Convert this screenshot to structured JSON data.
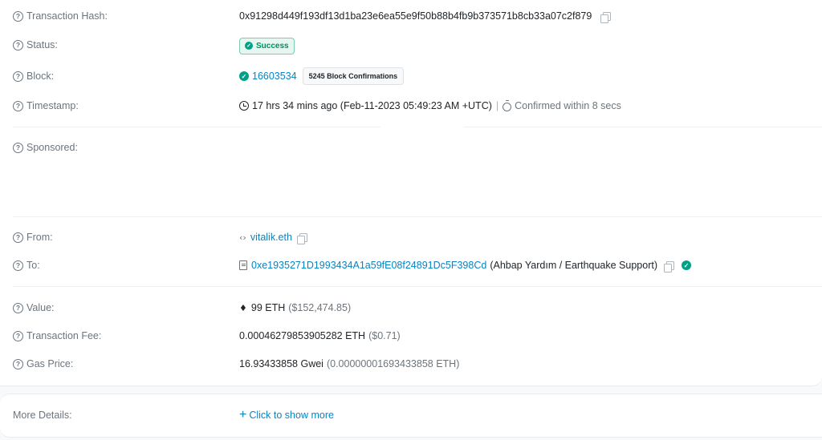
{
  "transaction": {
    "hash_label": "Transaction Hash:",
    "hash_value": "0x91298d449f193df13d1ba23e6ea55e9f50b88b4fb9b373571b8cb33a07c2f879",
    "status_label": "Status:",
    "status_value": "Success",
    "block_label": "Block:",
    "block_number": "16603534",
    "block_confirmations": "5245 Block Confirmations",
    "timestamp_label": "Timestamp:",
    "timestamp_value": "17 hrs 34 mins ago (Feb-11-2023 05:49:23 AM +UTC)",
    "confirmed_within": "Confirmed within 8 secs",
    "sponsored_label": "Sponsored:",
    "from_label": "From:",
    "from_value": "vitalik.eth",
    "to_label": "To:",
    "to_address": "0xe1935271D1993434A1a59fE08f24891Dc5F398Cd",
    "to_name": "(Ahbap Yardım / Earthquake Support)",
    "value_label": "Value:",
    "value_eth": "99 ETH",
    "value_usd": "($152,474.85)",
    "fee_label": "Transaction Fee:",
    "fee_eth": "0.00046279853905282 ETH",
    "fee_usd": "($0.71)",
    "gas_label": "Gas Price:",
    "gas_gwei": "16.93433858 Gwei",
    "gas_eth": "(0.00000001693433858 ETH)"
  },
  "more_details": {
    "label": "More Details:",
    "link": "Click to show more"
  },
  "icons": {
    "help": "question-circle-icon",
    "copy": "copy-icon",
    "verified": "check-circle-icon",
    "clock": "clock-icon",
    "stopwatch": "stopwatch-icon",
    "ens": "code-icon",
    "contract": "contract-file-icon",
    "eth": "ethereum-icon",
    "plus": "plus-icon"
  },
  "colors": {
    "link": "#0784c3",
    "success": "#00a186",
    "muted": "#6c757d"
  }
}
